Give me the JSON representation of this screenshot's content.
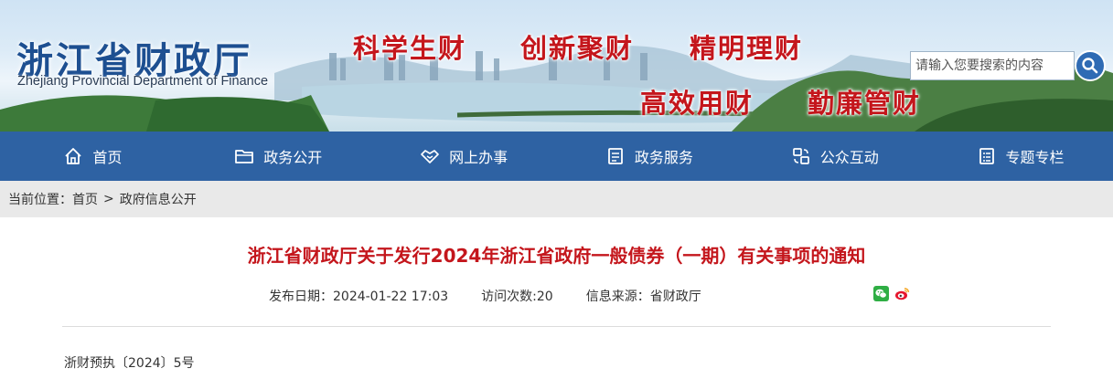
{
  "header": {
    "title": "浙江省财政厅",
    "subtitle": "Zhejiang Provincial Department of Finance",
    "slogans": [
      "科学生财",
      "创新聚财",
      "精明理财",
      "高效用财",
      "勤廉管财"
    ],
    "title_color": "#1d4f91",
    "slogan_color": "#c4161c"
  },
  "search": {
    "placeholder": "请输入您要搜索的内容",
    "button_icon": "search-icon"
  },
  "nav": {
    "background": "#2e62a3",
    "items": [
      {
        "label": "首页",
        "icon": "home-icon"
      },
      {
        "label": "政务公开",
        "icon": "folder-icon"
      },
      {
        "label": "网上办事",
        "icon": "handshake-icon"
      },
      {
        "label": "政务服务",
        "icon": "document-icon"
      },
      {
        "label": "公众互动",
        "icon": "interaction-icon"
      },
      {
        "label": "专题专栏",
        "icon": "list-icon"
      }
    ]
  },
  "breadcrumb": {
    "prefix": "当前位置：",
    "items": [
      "首页",
      "政府信息公开"
    ],
    "separator": ">"
  },
  "article": {
    "title": "浙江省财政厅关于发行2024年浙江省政府一般债券（一期）有关事项的通知",
    "publish_date": "发布日期：2024-01-22 17:03",
    "visits": "访问次数:20",
    "source": "信息来源：省财政厅",
    "share_icons": [
      "wechat-icon",
      "weibo-icon"
    ],
    "doc_number": "浙财预执〔2024〕5号"
  }
}
